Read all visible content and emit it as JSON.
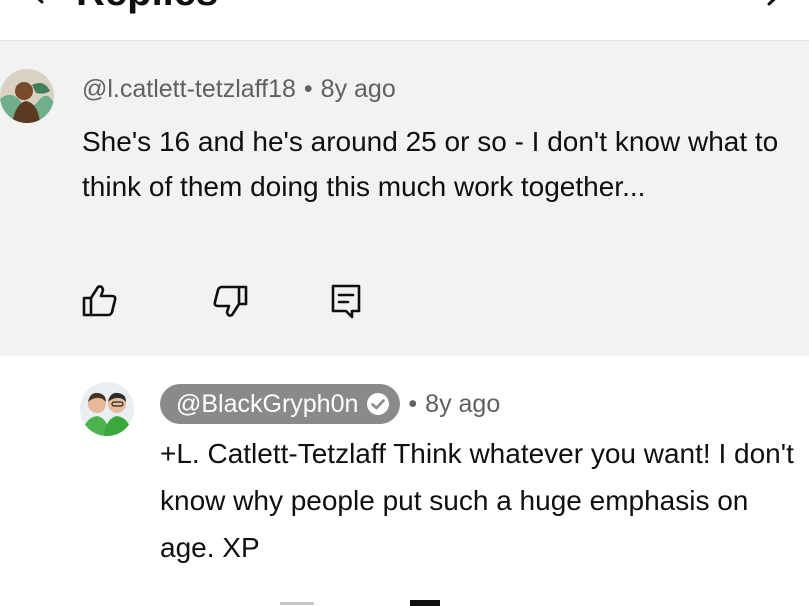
{
  "header": {
    "title": "Replies"
  },
  "parent_comment": {
    "author": "@l.catlett-tetzlaff18",
    "separator": "•",
    "time": "8y ago",
    "text": "She's 16 and he's around 25 or so - I don't know what to think of them doing this much work together..."
  },
  "reply_comment": {
    "author": "@BlackGryph0n",
    "separator": "•",
    "time": "8y ago",
    "text": "+L. Catlett-Tetzlaff Think whatever you want! I don't know why people put such a huge emphasis on age. XP"
  },
  "icons": {
    "like": "thumbs-up-icon",
    "dislike": "thumbs-down-icon",
    "reply": "reply-comment-icon",
    "verified": "verified-check-icon"
  },
  "colors": {
    "parent_background": "#f2f2f2",
    "meta_text": "#606060",
    "handle_chip": "#8a8a8a"
  }
}
